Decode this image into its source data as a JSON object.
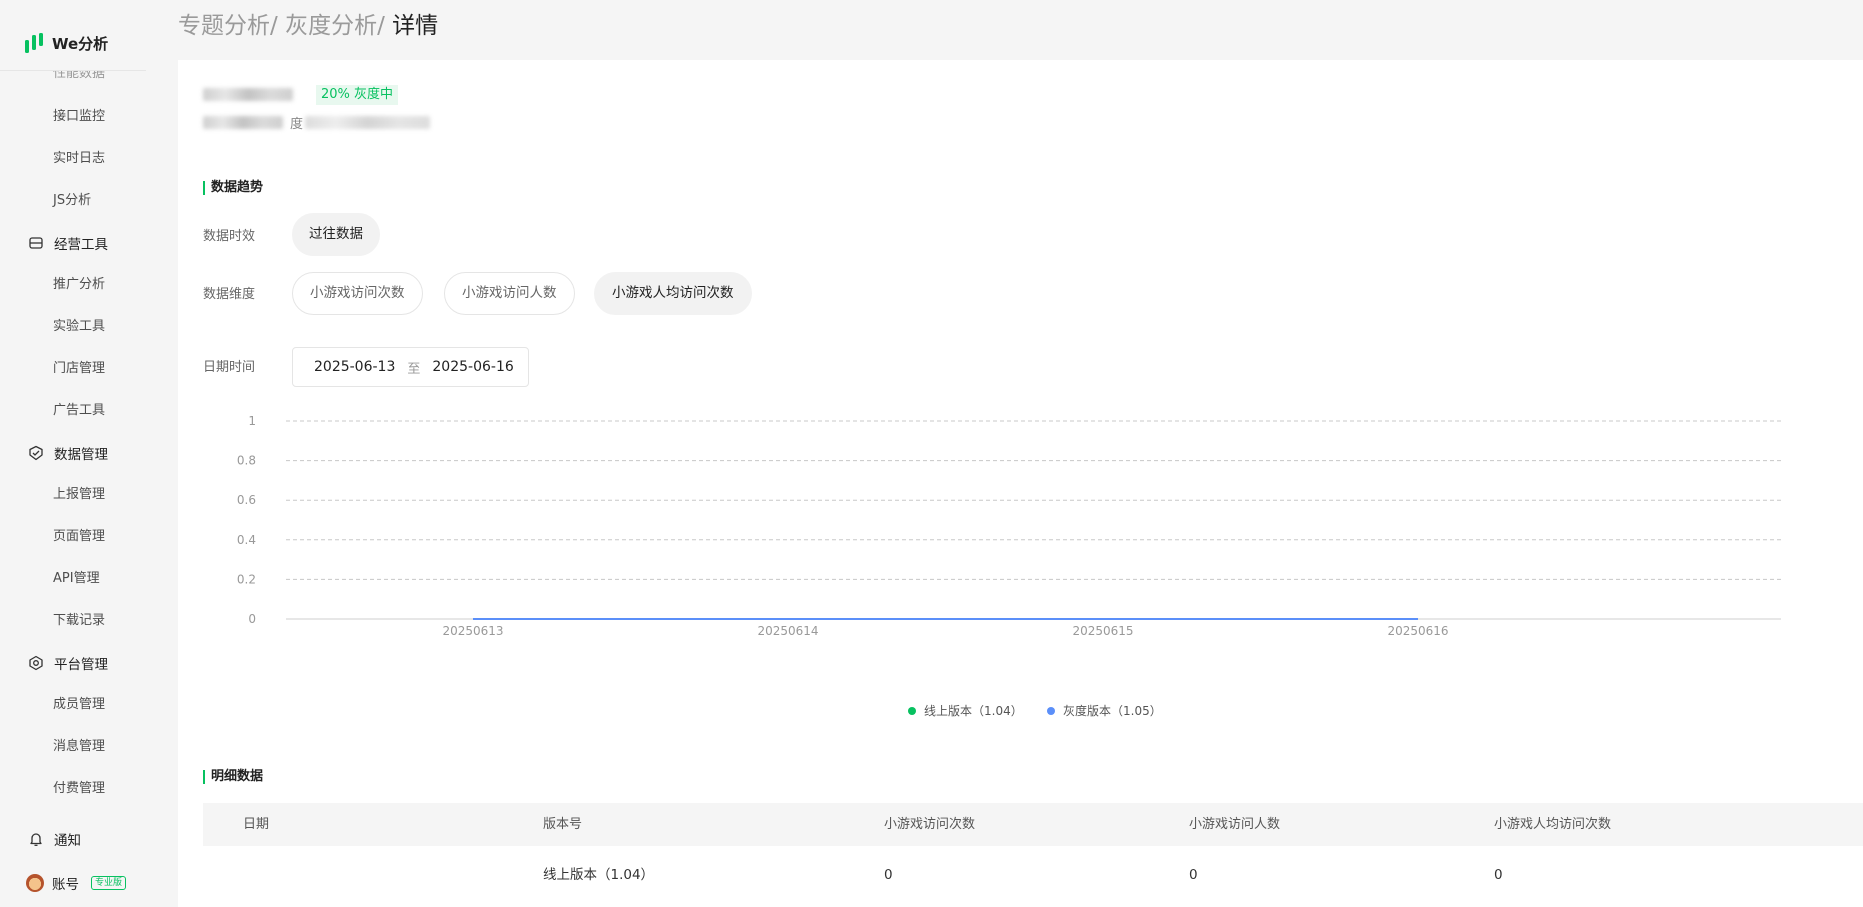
{
  "sidebar": {
    "logo_text": "We分析",
    "cut_item": "性能数据",
    "items": [
      {
        "label": "接口监控"
      },
      {
        "label": "实时日志"
      },
      {
        "label": "JS分析"
      }
    ],
    "groups": [
      {
        "label": "经营工具",
        "icon": "store-icon",
        "items": [
          "推广分析",
          "实验工具",
          "门店管理",
          "广告工具"
        ]
      },
      {
        "label": "数据管理",
        "icon": "data-shield-icon",
        "items": [
          "上报管理",
          "页面管理",
          "API管理",
          "下载记录"
        ]
      },
      {
        "label": "平台管理",
        "icon": "platform-hex-icon",
        "items": [
          "成员管理",
          "消息管理",
          "付费管理"
        ]
      }
    ],
    "notify_label": "通知",
    "account_label": "账号",
    "account_badge": "专业版"
  },
  "breadcrumb": {
    "part1": "专题分析/",
    "part2": "灰度分析/",
    "current": "详情"
  },
  "header": {
    "status_tag": "20% 灰度中",
    "subtitle_visible": "度",
    "subtitle_tail": "于 2025-06-13"
  },
  "trend": {
    "section_title": "数据趋势",
    "timeliness_label": "数据时效",
    "timeliness_option": "过往数据",
    "dimension_label": "数据维度",
    "dimensions": [
      "小游戏访问次数",
      "小游戏访问人数",
      "小游戏人均访问次数"
    ],
    "active_dimension": "小游戏人均访问次数",
    "date_label": "日期时间",
    "date_start": "2025-06-13",
    "date_sep": "至",
    "date_end": "2025-06-16"
  },
  "chart_data": {
    "type": "line",
    "x": [
      "20250613",
      "20250614",
      "20250615",
      "20250616"
    ],
    "ylim": [
      0,
      1
    ],
    "yticks": [
      "0",
      "0.2",
      "0.4",
      "0.6",
      "0.8",
      "1"
    ],
    "grid": true,
    "legend_placement": "bottom-center",
    "series": [
      {
        "name": "线上版本（1.04）",
        "values": [
          0,
          0,
          0,
          0
        ],
        "color": "#07c160"
      },
      {
        "name": "灰度版本（1.05）",
        "values": [
          0,
          0,
          0,
          0
        ],
        "color": "#5b8ff9"
      }
    ]
  },
  "detail": {
    "section_title": "明细数据",
    "columns": [
      "日期",
      "版本号",
      "小游戏访问次数",
      "小游戏访问人数",
      "小游戏人均访问次数"
    ],
    "rows": [
      {
        "date": "",
        "version": "线上版本（1.04）",
        "visits": "0",
        "visitors": "0",
        "avg": "0"
      }
    ]
  },
  "colors": {
    "accent": "#07c160",
    "series_gray_blue": "#5b8ff9"
  }
}
